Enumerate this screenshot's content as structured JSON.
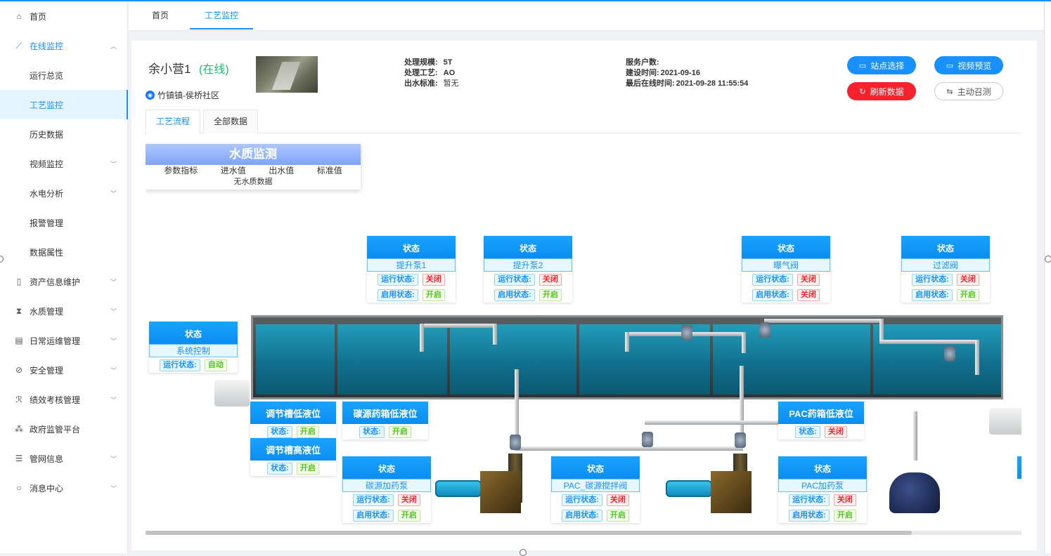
{
  "sidebar": {
    "items": [
      {
        "icon": "⌂",
        "label": "首页"
      },
      {
        "icon": "⟋",
        "label": "在线监控"
      },
      {
        "label": "运行总览"
      },
      {
        "label": "工艺监控"
      },
      {
        "label": "历史数据"
      },
      {
        "label": "视频监控"
      },
      {
        "label": "水电分析"
      },
      {
        "label": "报警管理"
      },
      {
        "label": "数据属性"
      },
      {
        "icon": "▯",
        "label": "资产信息维护"
      },
      {
        "icon": "⧗",
        "label": "水质管理"
      },
      {
        "icon": "▤",
        "label": "日常运维管理"
      },
      {
        "icon": "⊘",
        "label": "安全管理"
      },
      {
        "icon": "ℛ",
        "label": "绩效考核管理"
      },
      {
        "icon": "⁂",
        "label": "政府监管平台"
      },
      {
        "icon": "☰",
        "label": "管网信息"
      },
      {
        "icon": "○",
        "label": "消息中心"
      }
    ]
  },
  "tabs": [
    "首页",
    "工艺监控"
  ],
  "station": {
    "name": "余小营1",
    "status": "(在线)",
    "location": "竹镇镇-侯桥社区",
    "scale_label": "处理规模:",
    "scale": "5T",
    "process_label": "处理工艺:",
    "process": "AO",
    "standard_label": "出水标准:",
    "standard": "暂无",
    "households_label": "服务户数:",
    "households": "",
    "build_label": "建设时间:",
    "build": "2021-09-16",
    "last_online_label": "最后在线时间:",
    "last_online": "2021-09-28 11:55:54"
  },
  "buttons": {
    "site": "站点选择",
    "video": "视频预览",
    "refresh": "刷新数据",
    "call": "主动召测"
  },
  "subtabs": [
    "工艺流程",
    "全部数据"
  ],
  "water_quality": {
    "title": "水质监测",
    "cols": [
      "参数指标",
      "进水值",
      "出水值",
      "标准值"
    ],
    "empty": "无水质数据"
  },
  "labels": {
    "status": "状态",
    "run": "运行状态:",
    "enable": "启用状态:",
    "state": "状态:"
  },
  "values": {
    "off": "关闭",
    "on": "开启",
    "auto": "自动"
  },
  "devices": {
    "pump1": "提升泵1",
    "pump2": "提升泵2",
    "aeration": "曝气阀",
    "filter": "过滤阀",
    "system": "系统控制",
    "carbon_pump": "碳源加药泵",
    "pac_mixer": "PAC_碳源搅拌阀",
    "pac_pump": "PAC加药泵"
  },
  "levels": {
    "reg_low": "调节槽低液位",
    "reg_high": "调节槽高液位",
    "carbon_low": "碳源药箱低液位",
    "pac_low": "PAC药箱低液位"
  },
  "colors": {
    "accent": "#1890ff",
    "online": "#19be6b",
    "danger": "#f5222d",
    "success": "#52c41a"
  }
}
